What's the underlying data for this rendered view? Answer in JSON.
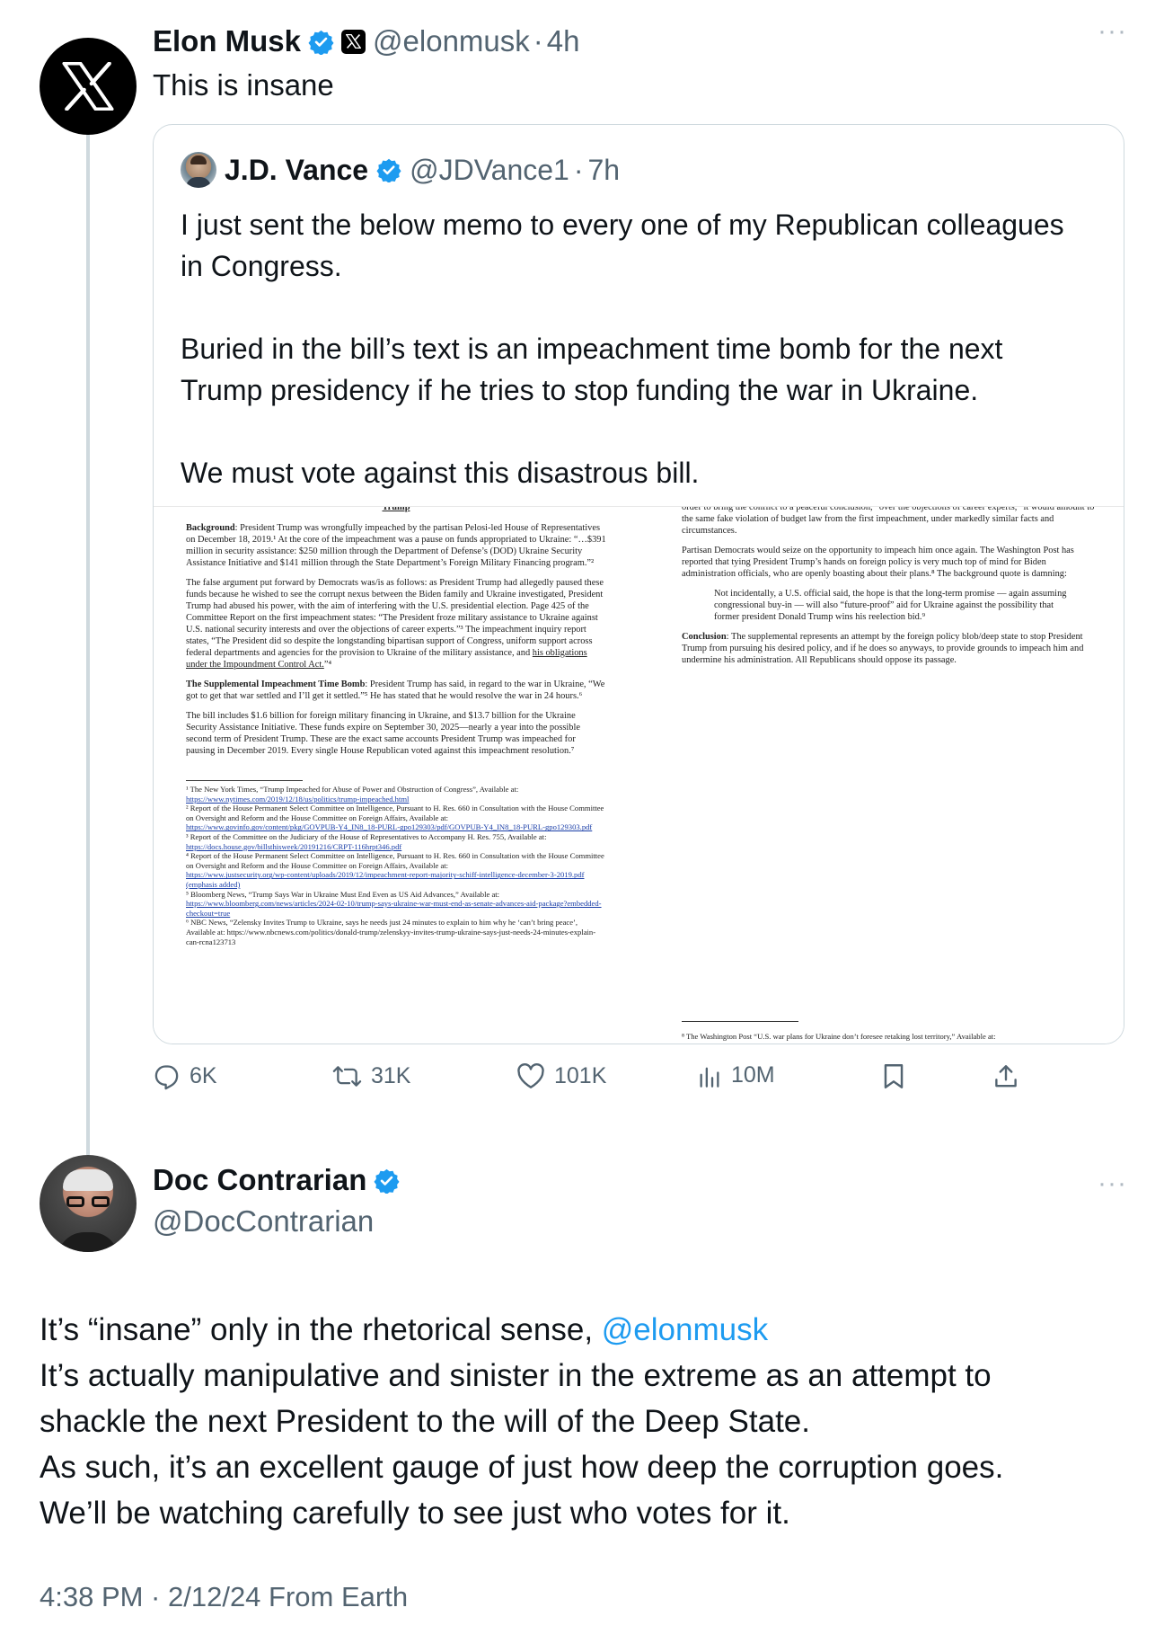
{
  "post": {
    "author_name": "Elon Musk",
    "handle": "@elonmusk",
    "dot": "·",
    "time": "4h",
    "text": "This is insane",
    "avatar_icon": "x-logo-icon"
  },
  "quote": {
    "author_name": "J.D. Vance",
    "handle": "@JDVance1",
    "dot": "·",
    "time": "7h",
    "paragraphs": [
      "I just sent the below memo to every one of my Republican colleagues in Congress.",
      "Buried in the bill’s text is an impeachment time bomb for the next Trump presidency if he tries to stop funding the war in Ukraine.",
      "We must vote against this disastrous bill."
    ],
    "memo_left": {
      "top_cut": "Trump",
      "p1_bold": "Background",
      "p1": ": President Trump was wrongfully impeached by the partisan Pelosi-led House of Representatives on December 18, 2019.¹  At the core of the impeachment was a pause on funds appropriated to Ukraine: “…$391 million in security assistance: $250 million through the Department of Defense’s (DOD) Ukraine Security Assistance Initiative and $141 million through the State Department’s Foreign Military Financing program.”²",
      "p2": "The false argument put forward by Democrats was/is as follows: as President Trump had allegedly paused these funds because he wished to see the corrupt nexus between the Biden family and Ukraine investigated, President Trump had abused his power, with the aim of interfering with the U.S. presidential election.  Page 425 of the Committee Report on the first impeachment states: “The President froze military assistance to Ukraine against U.S. national security interests and over the objections of career experts.”³  The impeachment inquiry report states, “The President did so despite the longstanding bipartisan support of Congress, uniform support across federal departments and agencies for the provision to Ukraine of the military assistance, and ",
      "p2_underline": "his obligations under the Impoundment Control Act.",
      "p2_end": "”⁴",
      "p3_bold": "The Supplemental Impeachment Time Bomb",
      "p3": ": President Trump has said, in regard to the war in Ukraine, “We got to get that war settled and I’ll get it settled.”⁵  He has stated that he would resolve the war in 24 hours.⁶",
      "p4": "The bill includes $1.6 billion for foreign military financing in Ukraine, and $13.7 billion for the Ukraine Security Assistance Initiative.  These funds expire on September 30, 2025—nearly a year into the possible second term of President Trump.  These are the exact same accounts President Trump was impeached for pausing in December 2019.  Every single House Republican voted against this impeachment resolution.⁷",
      "footnotes": [
        "¹ The New York Times, “Trump Impeached for Abuse of Power and Obstruction of Congress”, Available at:",
        "https://www.nytimes.com/2019/12/18/us/politics/trump-impeached.html",
        "² Report of the House Permanent Select Committee on Intelligence, Pursuant to H. Res. 660 in Consultation with the House Committee on Oversight and Reform and the House Committee on Foreign Affairs, Available at:",
        "https://www.govinfo.gov/content/pkg/GOVPUB-Y4_IN8_18-PURL-gpo129303/pdf/GOVPUB-Y4_IN8_18-PURL-gpo129303.pdf",
        "³ Report of the Committee on the Judiciary of the House of Representatives to Accompany H. Res. 755, Available at:",
        "https://docs.house.gov/billsthisweek/20191216/CRPT-116hrpt346.pdf",
        "⁴ Report of the House Permanent Select Committee on Intelligence, Pursuant to H. Res. 660 in Consultation with the House Committee on Oversight and Reform and the House Committee on Foreign Affairs, Available at:",
        "https://www.justsecurity.org/wp-content/uploads/2019/12/impeachment-report-majority-schiff-intelligence-december-3-2019.pdf (emphasis added)",
        "⁵ Bloomberg News, “Trump Says War in Ukraine Must End Even as US Aid Advances,” Available at:",
        "https://www.bloomberg.com/news/articles/2024-02-10/trump-says-ukraine-war-must-end-as-senate-advances-aid-package?embedded-checkout=true",
        "⁶ NBC News, “Zelensky Invites Trump to Ukraine, says he needs just 24 minutes to explain to him why he ‘can’t bring peace’, Available at: https://www.nbcnews.com/politics/donald-trump/zelenskyy-invites-trump-ukraine-says-just-needs-24-minutes-explain-can-rcna123713"
      ]
    },
    "memo_right": {
      "top_cut": "order to bring the conflict to a peaceful conclusion, “over the objections of career experts,” it would amount to the same fake violation of budget law from the first impeachment, under markedly similar facts and circumstances.",
      "p1": "Partisan Democrats would seize on the opportunity to impeach him once again.  The Washington Post has reported that tying President Trump’s hands on foreign policy is very much top of mind for Biden administration officials, who are openly boasting about their plans.⁸  The background quote is damning:",
      "quote": "Not incidentally, a U.S. official said, the hope is that the long-term promise — again assuming congressional buy-in — will also “future-proof” aid for Ukraine against the possibility that former president Donald Trump wins his reelection bid.⁹",
      "p2_bold": "Conclusion",
      "p2": ": The supplemental represents an attempt by the foreign policy blob/deep state to stop President Trump from pursuing his desired policy, and if he does so anyways, to provide grounds to impeach him and undermine his administration.  All Republicans should oppose its passage.",
      "footnote": "⁸ The Washington Post “U.S. war plans for Ukraine don’t foresee retaking lost territory,” Available at:"
    }
  },
  "actions": {
    "replies": "6K",
    "reposts": "31K",
    "likes": "101K",
    "views": "10M"
  },
  "reply": {
    "author_name": "Doc Contrarian",
    "handle": "@DocContrarian",
    "line1_a": "It’s “insane” only in the rhetorical sense, ",
    "line1_mention": "@elonmusk",
    "line2": "It’s actually manipulative and sinister in the extreme as an attempt to",
    "line3": "shackle the next President to the will of the Deep State.",
    "line4": "As such, it’s an excellent gauge of just how deep the corruption goes.",
    "line5": "We’ll be watching carefully to see just who votes for it.",
    "timestamp": "4:38 PM · 2/12/24 From Earth"
  },
  "colors": {
    "verified": "#1d9bf0",
    "link": "#1d9bf0",
    "muted": "#536471",
    "thread_line": "#cfd9de"
  }
}
